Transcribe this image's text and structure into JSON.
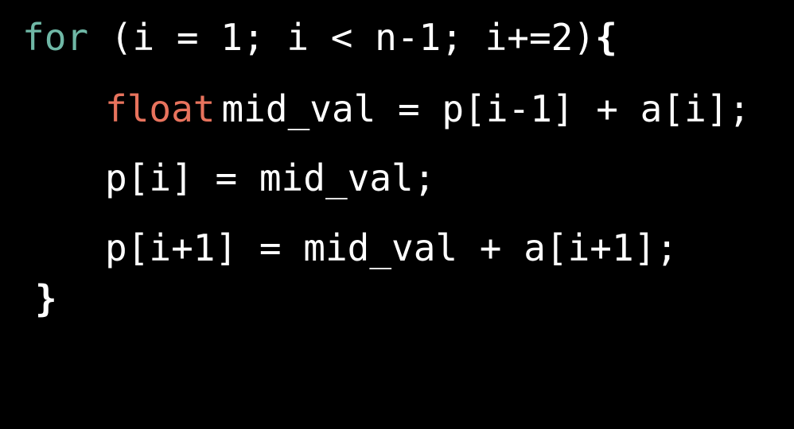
{
  "colors": {
    "background": "#000000",
    "text": "#ffffff",
    "keyword_for": "#6fb8a6",
    "keyword_float": "#e8735d"
  },
  "code": {
    "line1": {
      "keyword": "for",
      "rest": " (i = 1; i < n-1; i+=2)",
      "brace": "{"
    },
    "line2": {
      "type": "float",
      "rest": "mid_val = p[i-1] + a[i];"
    },
    "line3": {
      "text": "p[i] = mid_val;"
    },
    "line4": {
      "text": "p[i+1] = mid_val + a[i+1];"
    },
    "line5": {
      "brace": "}"
    }
  }
}
